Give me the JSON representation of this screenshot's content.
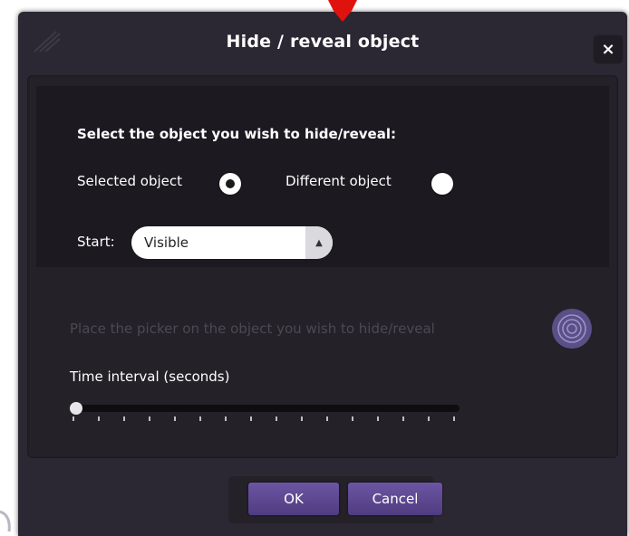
{
  "dialog": {
    "title": "Hide / reveal object",
    "close_label": "×"
  },
  "selection": {
    "heading": "Select the object you wish to hide/reveal:",
    "options": [
      {
        "label": "Selected object",
        "selected": true
      },
      {
        "label": "Different object",
        "selected": false
      }
    ]
  },
  "start": {
    "label": "Start:",
    "value": "Visible"
  },
  "picker": {
    "text": "Place the picker on the object you wish to hide/reveal"
  },
  "time_interval": {
    "label": "Time interval (seconds)",
    "value_fraction": 0.0
  },
  "buttons": {
    "ok": "OK",
    "cancel": "Cancel"
  },
  "colors": {
    "dialog_bg": "#2c2833",
    "panel_bg": "#242128",
    "inner_panel_bg": "#1c1a20",
    "button_accent": "#5a4690",
    "annotation_arrow": "#e0120e"
  },
  "icons": {
    "annotation": "red-arrow-icon",
    "picker": "picker-target-icon",
    "grip": "resize-grip-icon"
  }
}
